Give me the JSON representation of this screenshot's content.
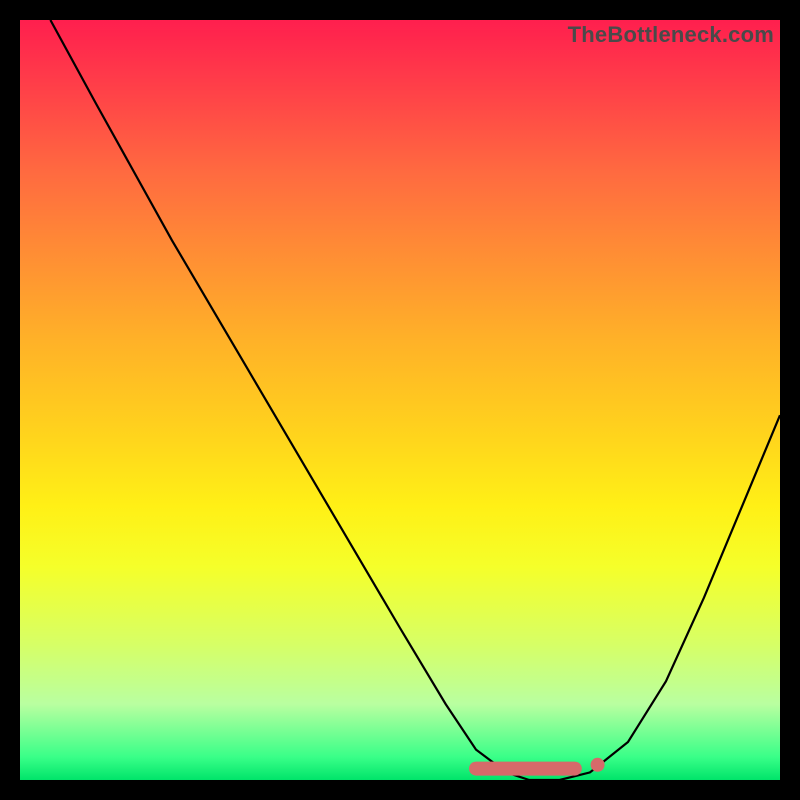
{
  "watermark": "TheBottleneck.com",
  "chart_data": {
    "type": "line",
    "title": "",
    "xlabel": "",
    "ylabel": "",
    "xlim": [
      0,
      100
    ],
    "ylim": [
      0,
      100
    ],
    "grid": false,
    "series": [
      {
        "name": "bottleneck-curve",
        "x": [
          4,
          10,
          20,
          30,
          40,
          50,
          56,
          60,
          64,
          67,
          71,
          75,
          80,
          85,
          90,
          95,
          100
        ],
        "values": [
          100,
          89,
          71,
          54,
          37,
          20,
          10,
          4,
          1,
          0,
          0,
          1,
          5,
          13,
          24,
          36,
          48
        ]
      }
    ],
    "markers": [
      {
        "name": "flat-segment",
        "x_range": [
          60,
          73
        ],
        "y": 1.5,
        "color": "#d66a6a",
        "style": "thick-round"
      },
      {
        "name": "end-dot",
        "x": 76,
        "y": 2,
        "color": "#d66a6a"
      }
    ],
    "gradient_stops": [
      {
        "pct": 0,
        "color": "#ff1f4e"
      },
      {
        "pct": 20,
        "color": "#ff6a40"
      },
      {
        "pct": 42,
        "color": "#ffb128"
      },
      {
        "pct": 64,
        "color": "#fff016"
      },
      {
        "pct": 90,
        "color": "#b9ffa0"
      },
      {
        "pct": 100,
        "color": "#00e46a"
      }
    ]
  }
}
